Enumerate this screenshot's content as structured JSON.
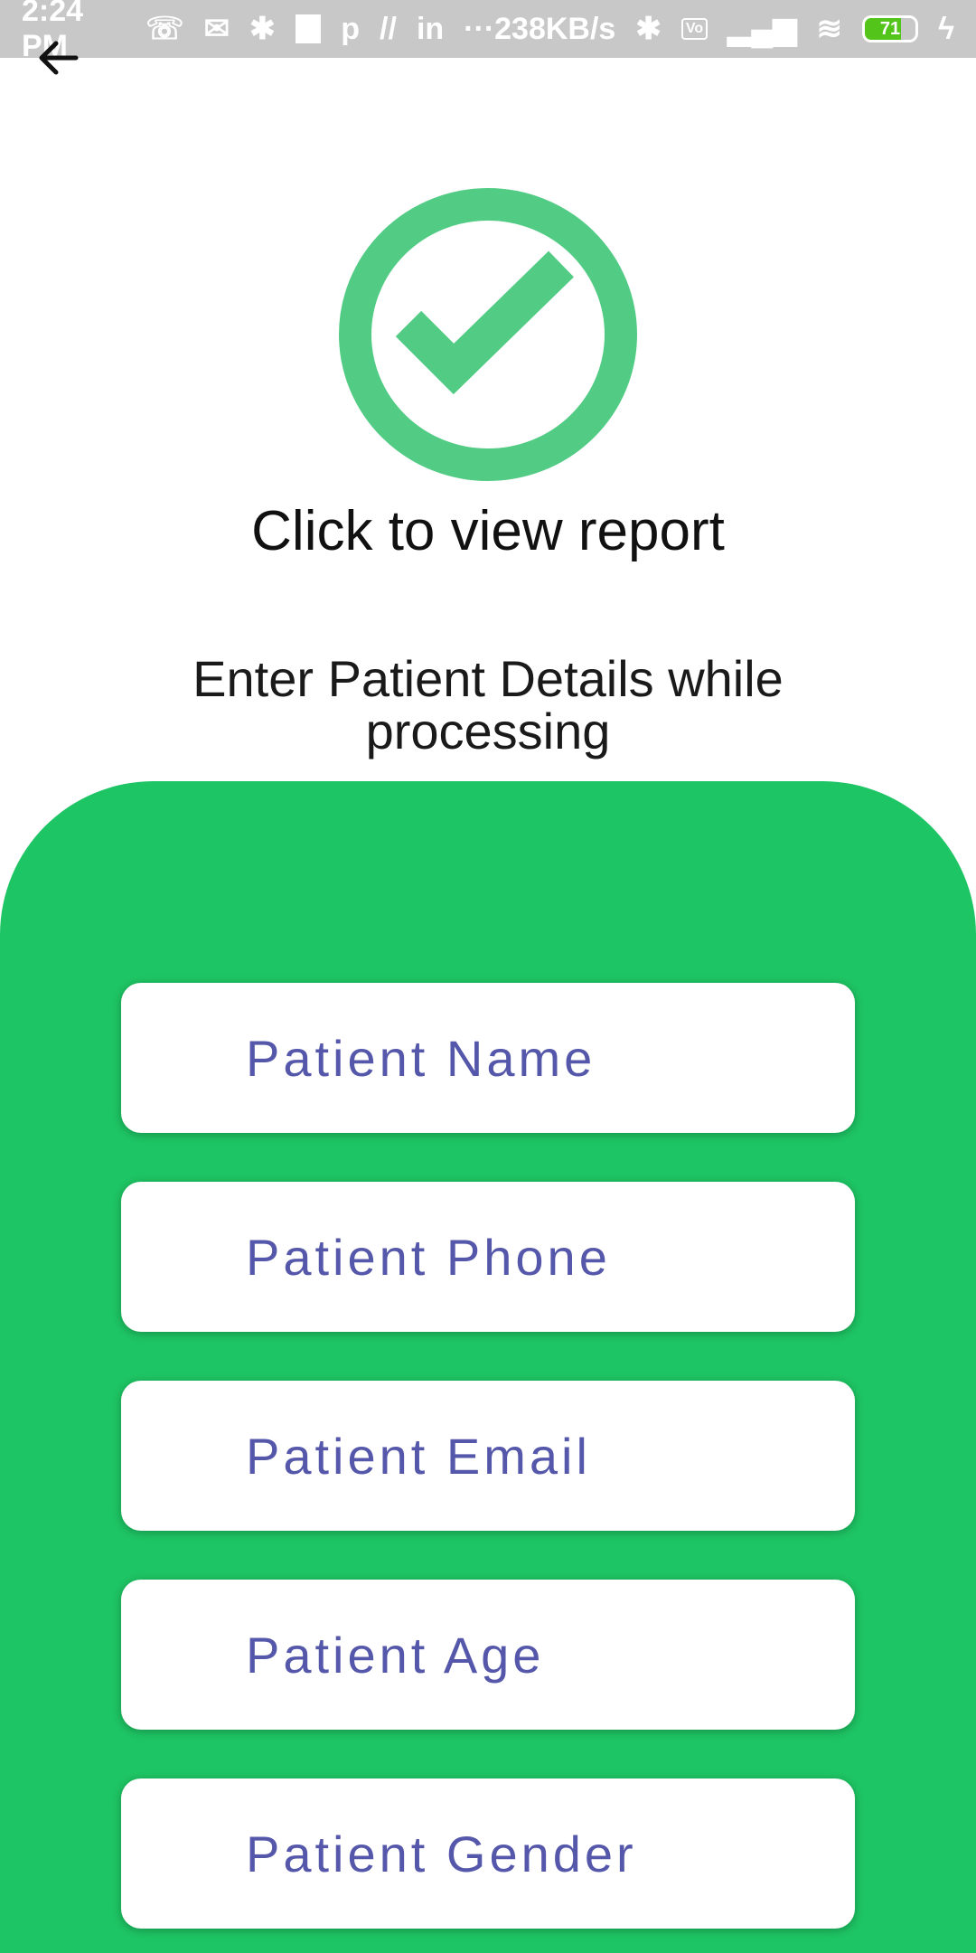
{
  "status_bar": {
    "time": "2:24 PM",
    "network_speed": "238KB/s",
    "battery_level": "71",
    "icons": [
      "missed-call-icon",
      "notification-icon",
      "slack-icon",
      "square-icon",
      "p-icon",
      "n-icon",
      "linkedin-icon",
      "more-icon",
      "bluetooth-icon",
      "volte-icon",
      "signal-icon",
      "wifi-icon",
      "battery-icon",
      "charging-icon"
    ]
  },
  "header": {
    "back_icon": "arrow-left-icon"
  },
  "main": {
    "success_icon": "check-circle-icon",
    "report_link": "Click to view report",
    "subtitle": "Enter Patient Details while processing"
  },
  "form": {
    "fields": [
      {
        "placeholder": "Patient Name"
      },
      {
        "placeholder": "Patient Phone"
      },
      {
        "placeholder": "Patient Email"
      },
      {
        "placeholder": "Patient Age"
      },
      {
        "placeholder": "Patient Gender"
      }
    ]
  },
  "colors": {
    "accent_green": "#1ec564",
    "check_green": "#52cc85",
    "placeholder_text": "#5557aa",
    "status_bar_bg": "#c8c8c8"
  }
}
